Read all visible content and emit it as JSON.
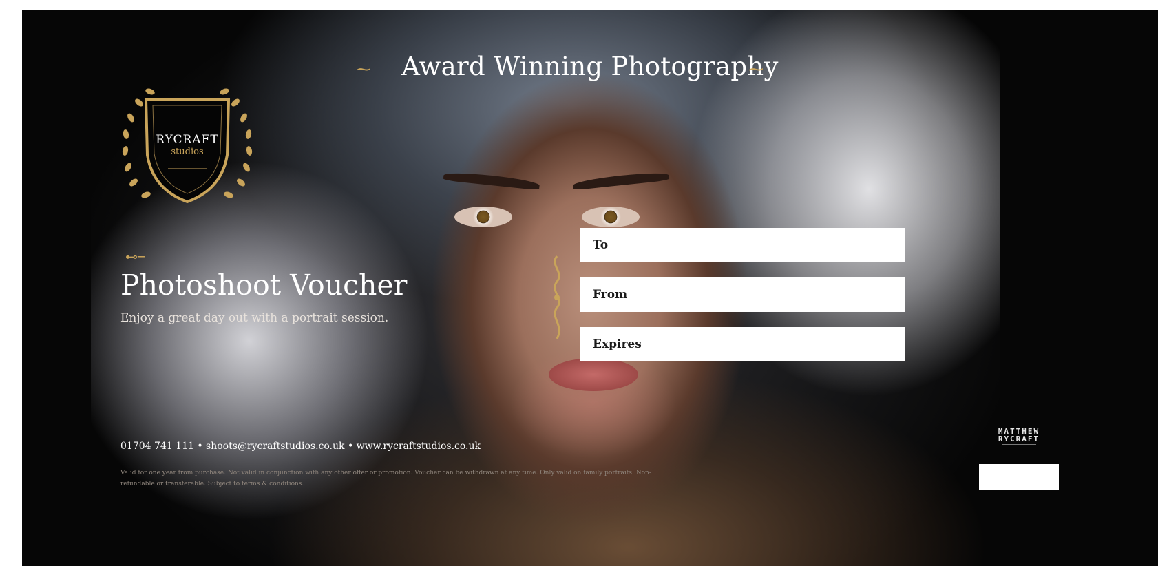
{
  "voucher": {
    "headline": "Award Winning Photography",
    "crest": {
      "name_top": "RYCRAFT",
      "name_bottom": "studios"
    },
    "title": "Photoshoot Voucher",
    "subtitle": "Enjoy a great day out with a portrait session.",
    "fields": [
      {
        "label": "To"
      },
      {
        "label": "From"
      },
      {
        "label": "Expires"
      }
    ],
    "contact": "01704 741 111 • shoots@rycraftstudios.co.uk • www.rycraftstudios.co.uk",
    "terms": "Valid for one year from purchase. Not valid in conjunction with any other offer or promotion. Voucher can be withdrawn at any time. Only valid on family portraits. Non-refundable or transferable. Subject to terms & conditions.",
    "brand": {
      "line1": "MATTHEW",
      "line2": "RYCRAFT"
    },
    "colors": {
      "background": "#060606",
      "gold": "#c9a45a",
      "text": "#ffffff",
      "field_bg": "#ffffff"
    }
  }
}
